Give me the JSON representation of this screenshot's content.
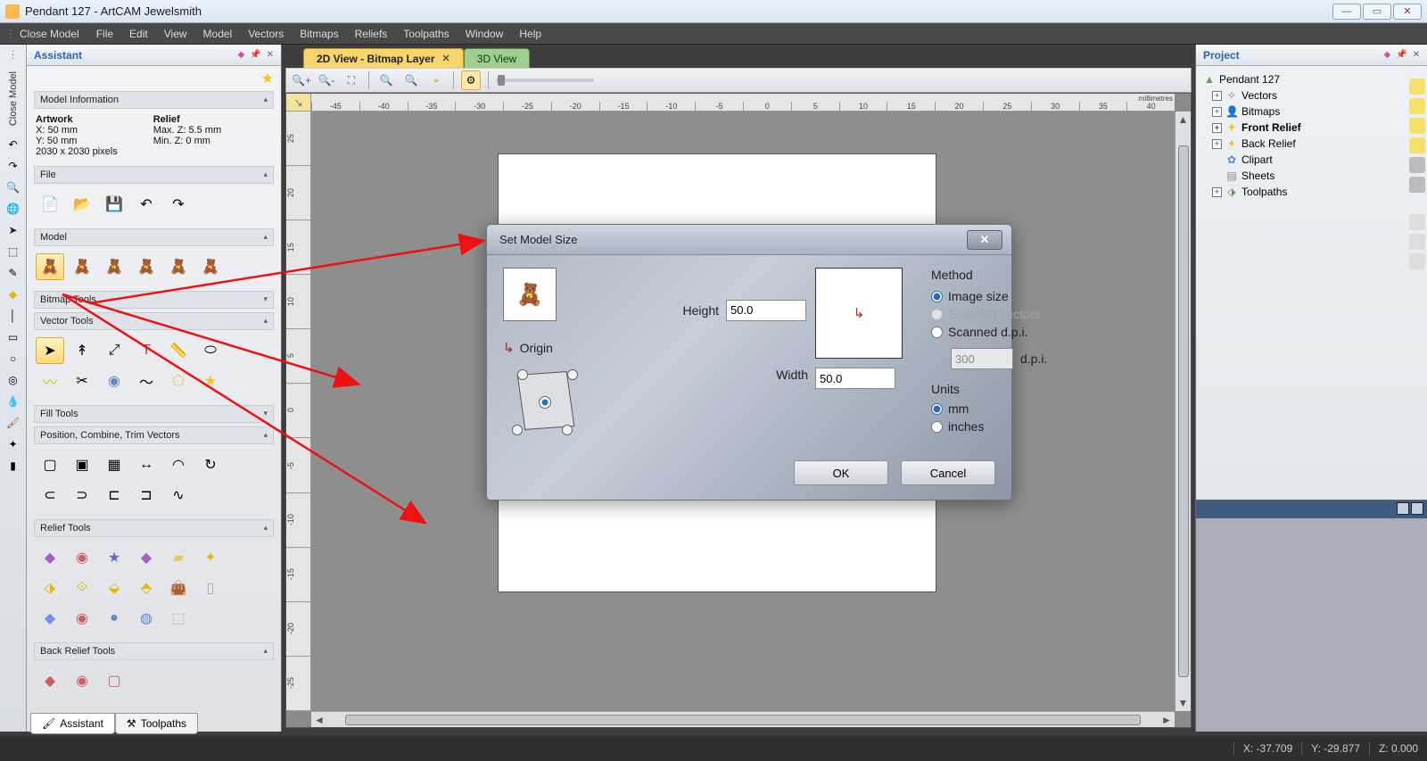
{
  "app": {
    "title": "Pendant 127 - ArtCAM Jewelsmith"
  },
  "menubar": {
    "closemodel": "Close Model",
    "items": [
      "File",
      "Edit",
      "View",
      "Model",
      "Vectors",
      "Bitmaps",
      "Reliefs",
      "Toolpaths",
      "Window",
      "Help"
    ]
  },
  "assistant": {
    "title": "Assistant",
    "sections": {
      "modelinfo": {
        "head": "Model Information",
        "artwork_label": "Artwork",
        "artwork_x": "X: 50 mm",
        "artwork_y": "Y: 50 mm",
        "resolution": "2030 x 2030 pixels",
        "relief_label": "Relief",
        "max_z": "Max. Z: 5.5 mm",
        "min_z": "Min. Z: 0 mm"
      },
      "file": "File",
      "model": "Model",
      "bitmap": "Bitmap Tools",
      "vector": "Vector Tools",
      "fill": "Fill Tools",
      "position": "Position, Combine, Trim Vectors",
      "relief": "Relief Tools",
      "backrelief": "Back Relief Tools"
    }
  },
  "views": {
    "tab_2d": "2D View - Bitmap Layer",
    "tab_3d": "3D View"
  },
  "ruler": {
    "h": [
      "-45",
      "-40",
      "-35",
      "-30",
      "-25",
      "-20",
      "-15",
      "-10",
      "-5",
      "0",
      "5",
      "10",
      "15",
      "20",
      "25",
      "30",
      "35",
      "40"
    ],
    "unit": "millimetres",
    "v": [
      "25",
      "20",
      "15",
      "10",
      "5",
      "0",
      "-5",
      "-10",
      "-15",
      "-20",
      "-25"
    ]
  },
  "dialog": {
    "title": "Set Model Size",
    "height_label": "Height",
    "height_value": "50.0",
    "width_label": "Width",
    "width_value": "50.0",
    "origin_label": "Origin",
    "method_label": "Method",
    "method_image": "Image size",
    "method_selected": "Selected vectors",
    "method_scanned": "Scanned d.p.i.",
    "dpi_value": "300",
    "dpi_label": "d.p.i.",
    "units_label": "Units",
    "units_mm": "mm",
    "units_in": "inches",
    "ok": "OK",
    "cancel": "Cancel"
  },
  "project": {
    "title": "Project",
    "root": "Pendant 127",
    "nodes": {
      "vectors": "Vectors",
      "bitmaps": "Bitmaps",
      "front": "Front Relief",
      "back": "Back Relief",
      "clipart": "Clipart",
      "sheets": "Sheets",
      "toolpaths": "Toolpaths"
    }
  },
  "tabs": {
    "assistant": "Assistant",
    "toolpaths": "Toolpaths"
  },
  "status": {
    "x": "X: -37.709",
    "y": "Y: -29.877",
    "z": "Z: 0.000"
  },
  "leftgutter": {
    "closemodel": "Close Model"
  }
}
